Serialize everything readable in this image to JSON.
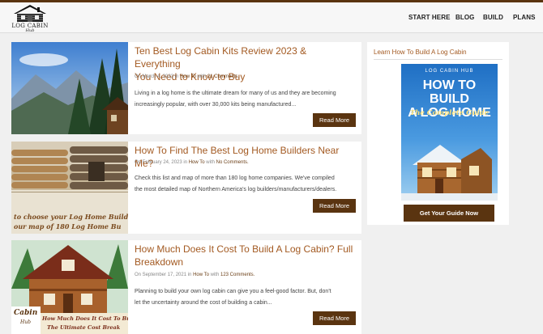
{
  "header": {
    "logo_text": "LOG CABIN",
    "logo_script": "Hub",
    "nav": [
      "START HERE",
      "BLOG",
      "BUILD",
      "PLANS"
    ]
  },
  "posts": [
    {
      "title_line1": "Ten Best Log Cabin Kits Review 2023 & Everything",
      "title_line2": "You Need to Know to Buy",
      "date": "On March 4, 2023 in",
      "category": "How To",
      "with": "with",
      "comments": "21 Comments.",
      "excerpt_line1": "Living in a log home is the ultimate dream for many of us and they are becoming",
      "excerpt_line2": "increasingly popular, with over 30,000 kits being manufactured...",
      "read_more": "Read More"
    },
    {
      "title_line1": "How To Find The Best Log Home Builders Near Me?",
      "date": "On February 24, 2023 in",
      "category": "How To",
      "with": "with",
      "comments": "No Comments.",
      "excerpt_line1": "Check this list and map of more than 180 log home companies. We've compiled",
      "excerpt_line2": "the most detailed map of Northern America's log builders/manufacturers/dealers.",
      "read_more": "Read More",
      "image_text_line1": "to choose your Log Home Builde",
      "image_text_line2": "our map of 180 Log Home Bu"
    },
    {
      "title_line1": "How Much Does It Cost To Build A Log Cabin? Full",
      "title_line2": "Breakdown",
      "date": "On September 17, 2021 in",
      "category": "How To",
      "with": "with",
      "comments": "123 Comments.",
      "excerpt_line1": "Planning to build your own log cabin can give you a feel-good factor. But, don't",
      "excerpt_line2": "let the uncertainty around the cost of building a cabin...",
      "read_more": "Read More",
      "image_badge_line1": "Cabin",
      "image_badge_line2": "Hub",
      "image_text_line1": "How Much Does It Cost To Build",
      "image_text_line2": "The Ultimate Cost Break"
    }
  ],
  "sidebar": {
    "title": "Learn How To Build A Log Cabin",
    "book_brand": "LOG CABIN HUB",
    "book_title_line1": "HOW TO BUILD",
    "book_title_line2": "A LOG HOME",
    "book_subtitle": "The Complete Guide",
    "button": "Get Your Guide Now"
  },
  "colors": {
    "accent_brown": "#5a3410",
    "title_orange": "#a35a22",
    "book_blue": "#1f6fc4"
  }
}
